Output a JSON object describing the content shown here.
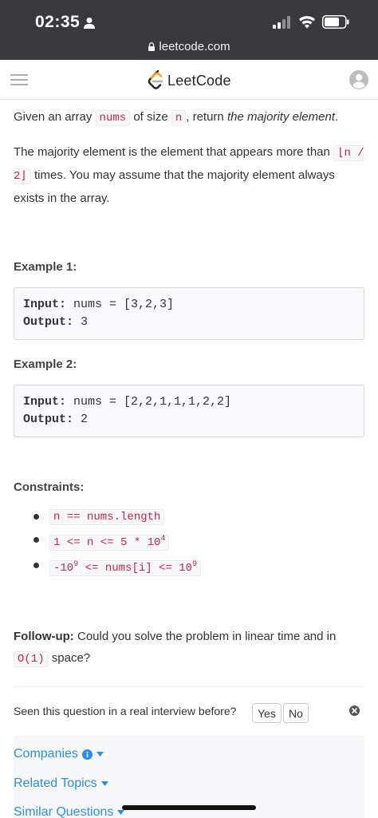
{
  "status_bar": {
    "time": "02:35",
    "url": "leetcode.com"
  },
  "header": {
    "logo_text": "LeetCode"
  },
  "problem": {
    "p1": {
      "t1": "Given an array ",
      "c1": "nums",
      "t2": " of size ",
      "c2": "n",
      "t3": ", return ",
      "em": "the majority element",
      "t4": "."
    },
    "p2": {
      "t1": "The majority element is the element that appears more than ",
      "c1": "⌊n / 2⌋",
      "t2": " times. You may assume that the majority element always exists in the array."
    }
  },
  "examples": [
    {
      "heading": "Example 1:",
      "input_label": "Input:",
      "input": " nums = [3,2,3]",
      "output_label": "Output:",
      "output": " 3"
    },
    {
      "heading": "Example 2:",
      "input_label": "Input:",
      "input": " nums = [2,2,1,1,1,2,2]",
      "output_label": "Output:",
      "output": " 2"
    }
  ],
  "constraints": {
    "heading": "Constraints:",
    "items": [
      {
        "text": "n == nums.length"
      },
      {
        "text": "1 <= n <= 5 * 10",
        "sup": "4"
      },
      {
        "a": "-10",
        "sup1": "9",
        "b": " <= nums[i] <= 10",
        "sup2": "9"
      }
    ]
  },
  "followup": {
    "label": "Follow-up:",
    "t1": " Could you solve the problem in linear time and in ",
    "c1": "O(1)",
    "t2": " space?"
  },
  "feedback": {
    "question": "Seen this question in a real interview before?",
    "yes": "Yes",
    "no": "No"
  },
  "meta": {
    "companies": "Companies",
    "related_topics": "Related Topics",
    "similar_questions": "Similar Questions"
  },
  "colors": {
    "status_bar_bg": "#3a3a3c",
    "code_text": "#c7254e",
    "link": "#2d8dea"
  }
}
